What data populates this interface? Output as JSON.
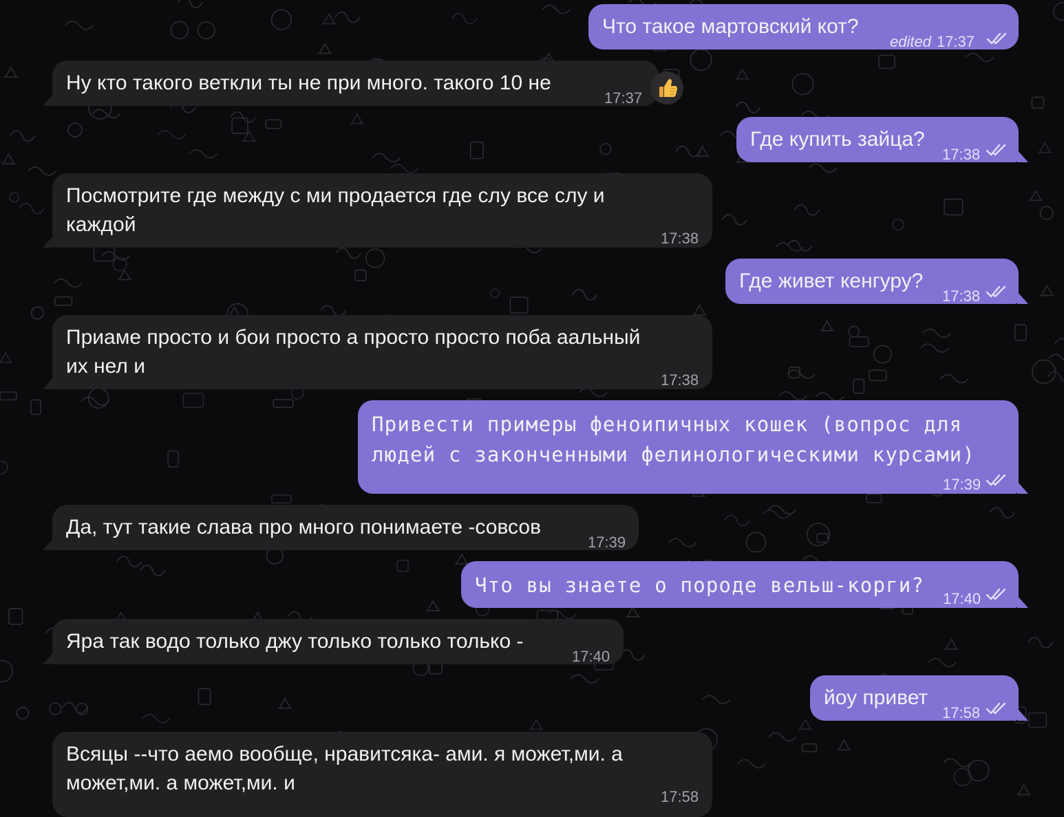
{
  "messages": [
    {
      "dir": "out",
      "text": "Что такое мартовский кот?",
      "time": "17:37",
      "edited": "edited"
    },
    {
      "dir": "in",
      "text": "Ну кто такого веткли ты не при много. такого 10 не",
      "time": "17:37",
      "reaction": "thumbs-up"
    },
    {
      "dir": "out",
      "text": "Где купить зайца?",
      "time": "17:38"
    },
    {
      "dir": "in",
      "lines": [
        "Посмотрите где между с ми продается где слу все слу и",
        "каждой"
      ],
      "time": "17:38"
    },
    {
      "dir": "out",
      "text": "Где живет кенгуру?",
      "time": "17:38"
    },
    {
      "dir": "in",
      "lines": [
        "Приаме просто и бои просто а просто просто поба аальный",
        "их нел и"
      ],
      "time": "17:38"
    },
    {
      "dir": "out",
      "lines": [
        "Привести примеры феноипичных кошек (вопрос для",
        "людей с законченными фелинологическими курсами)"
      ],
      "time": "17:39"
    },
    {
      "dir": "in",
      "text": "Да, тут такие слава про много понимаете -совсов",
      "time": "17:39"
    },
    {
      "dir": "out",
      "text": "Что вы знаете о породе вельш-корги?",
      "time": "17:40"
    },
    {
      "dir": "in",
      "text": "Яра так водо только джу только только только -",
      "time": "17:40"
    },
    {
      "dir": "out",
      "text": "йоу привет",
      "time": "17:58"
    },
    {
      "dir": "in",
      "lines": [
        "Всяцы --что аемо вообще, нравитсяка- ами. я может,ми. а",
        "может,ми. а может,ми. и"
      ],
      "time": "17:58"
    }
  ],
  "colors": {
    "background": "#0b0b0d",
    "incoming_bubble": "#212123",
    "outgoing_bubble": "#8272d4",
    "text": "#f1f1f3",
    "time_in": "#a2a2a8",
    "time_out": "#e4e0fa"
  },
  "icons": {
    "read_receipt": "double-check-icon",
    "reaction": "thumbs-up-icon"
  }
}
